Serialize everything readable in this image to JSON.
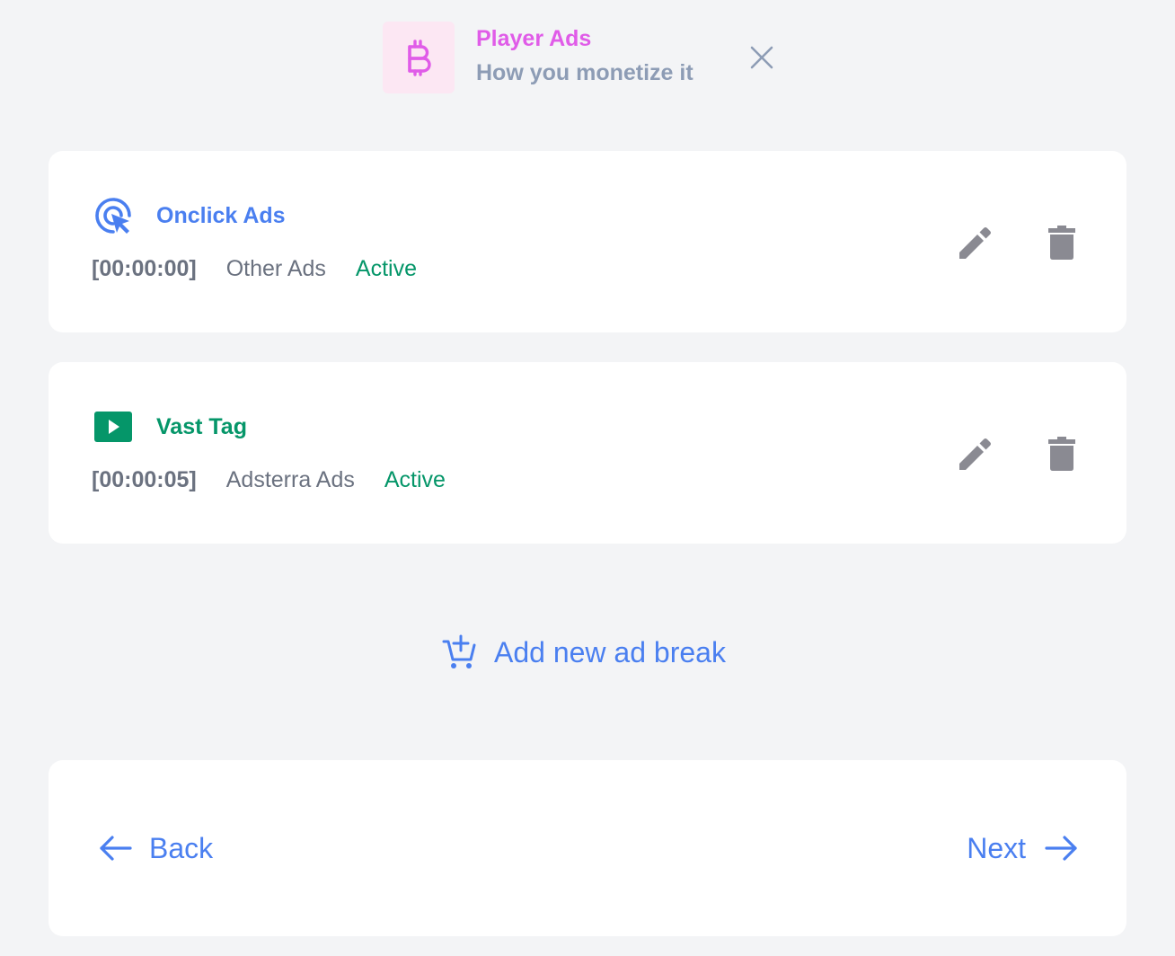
{
  "header": {
    "title": "Player Ads",
    "subtitle": "How you monetize it",
    "icon": "bitcoin-icon",
    "close_icon": "close-icon"
  },
  "ad_breaks": [
    {
      "type_label": "Onclick Ads",
      "type_icon": "cursor-click-icon",
      "time": "[00:00:00]",
      "network": "Other Ads",
      "status": "Active"
    },
    {
      "type_label": "Vast Tag",
      "type_icon": "play-box-icon",
      "time": "[00:00:05]",
      "network": "Adsterra Ads",
      "status": "Active"
    }
  ],
  "add_break": {
    "label": "Add new ad break",
    "icon": "cart-plus-icon"
  },
  "nav": {
    "back_label": "Back",
    "next_label": "Next"
  },
  "colors": {
    "accent_blue": "#4a7ff0",
    "accent_green": "#059669",
    "accent_pink": "#e05ce8",
    "icon_gray": "#8a8a92",
    "background": "#f3f4f6"
  }
}
